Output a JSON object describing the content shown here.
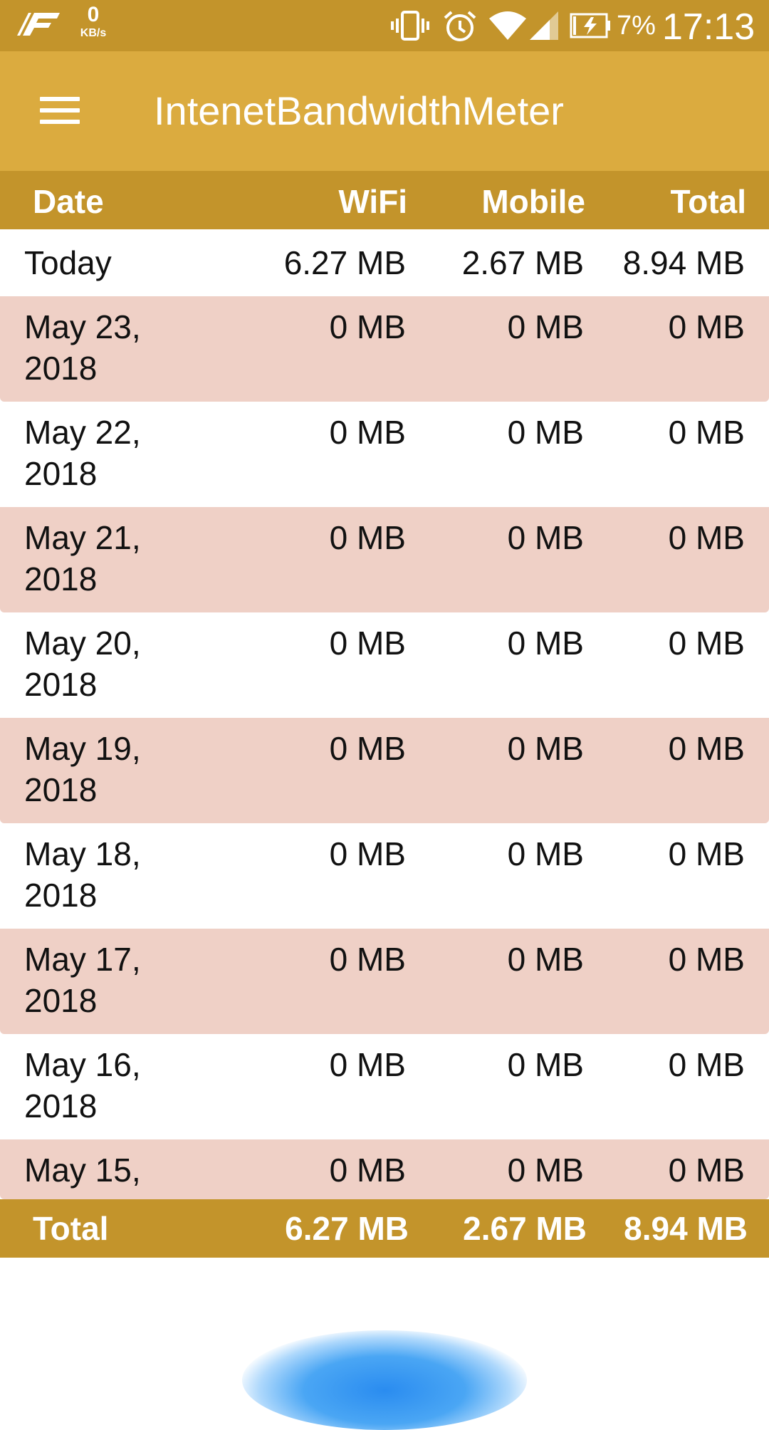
{
  "status_bar": {
    "speed_value": "0",
    "speed_unit": "KB/s",
    "battery_percent": "7%",
    "time": "17:13",
    "icons": [
      "app-logo-icon",
      "vibrate-icon",
      "alarm-icon",
      "wifi-icon",
      "signal-icon",
      "battery-charging-icon"
    ]
  },
  "app_bar": {
    "title": "IntenetBandwidthMeter",
    "menu_icon": "hamburger-menu-icon"
  },
  "table": {
    "headers": {
      "date": "Date",
      "wifi": "WiFi",
      "mobile": "Mobile",
      "total": "Total"
    },
    "rows": [
      {
        "date": "Today",
        "wifi": "6.27 MB",
        "mobile": "2.67 MB",
        "total": "8.94 MB"
      },
      {
        "date": "May 23, 2018",
        "wifi": "0 MB",
        "mobile": "0 MB",
        "total": "0 MB"
      },
      {
        "date": "May 22, 2018",
        "wifi": "0 MB",
        "mobile": "0 MB",
        "total": "0 MB"
      },
      {
        "date": "May 21, 2018",
        "wifi": "0 MB",
        "mobile": "0 MB",
        "total": "0 MB"
      },
      {
        "date": "May 20, 2018",
        "wifi": "0 MB",
        "mobile": "0 MB",
        "total": "0 MB"
      },
      {
        "date": "May 19, 2018",
        "wifi": "0 MB",
        "mobile": "0 MB",
        "total": "0 MB"
      },
      {
        "date": "May 18, 2018",
        "wifi": "0 MB",
        "mobile": "0 MB",
        "total": "0 MB"
      },
      {
        "date": "May 17, 2018",
        "wifi": "0 MB",
        "mobile": "0 MB",
        "total": "0 MB"
      },
      {
        "date": "May 16, 2018",
        "wifi": "0 MB",
        "mobile": "0 MB",
        "total": "0 MB"
      },
      {
        "date": "May 15,",
        "wifi": "0 MB",
        "mobile": "0 MB",
        "total": "0 MB"
      }
    ],
    "footer": {
      "label": "Total",
      "wifi": "6.27 MB",
      "mobile": "2.67 MB",
      "total": "8.94 MB"
    }
  },
  "colors": {
    "status_bar": "#c3942b",
    "app_bar": "#dbab3f",
    "header_footer": "#c3942b",
    "alt_row": "#efd0c6",
    "plain_row": "#ffffff",
    "glow": "#2a8cf0"
  }
}
